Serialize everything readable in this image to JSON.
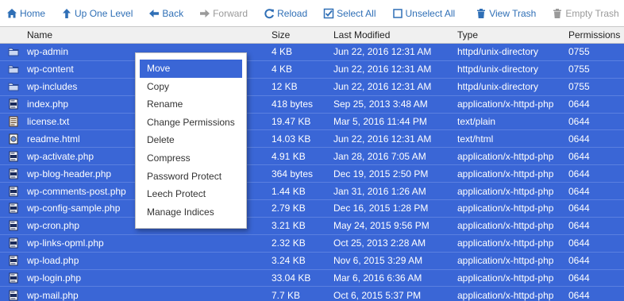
{
  "toolbar": {
    "home": {
      "label": "Home",
      "icon": "home-icon"
    },
    "up": {
      "label": "Up One Level",
      "icon": "arrow-up-icon"
    },
    "back": {
      "label": "Back",
      "icon": "arrow-left-icon"
    },
    "forward": {
      "label": "Forward",
      "icon": "arrow-right-icon"
    },
    "reload": {
      "label": "Reload",
      "icon": "reload-icon"
    },
    "select_all": {
      "label": "Select All",
      "icon": "checkbox-checked-icon"
    },
    "unselect_all": {
      "label": "Unselect All",
      "icon": "checkbox-empty-icon"
    },
    "view_trash": {
      "label": "View Trash",
      "icon": "trash-icon"
    },
    "empty_trash": {
      "label": "Empty Trash",
      "icon": "trash-icon"
    }
  },
  "columns": {
    "name": "Name",
    "size": "Size",
    "modified": "Last Modified",
    "type": "Type",
    "permissions": "Permissions"
  },
  "files": [
    {
      "name": "wp-admin",
      "size": "4 KB",
      "modified": "Jun 22, 2016 12:31 AM",
      "type": "httpd/unix-directory",
      "perm": "0755",
      "kind": "folder"
    },
    {
      "name": "wp-content",
      "size": "4 KB",
      "modified": "Jun 22, 2016 12:31 AM",
      "type": "httpd/unix-directory",
      "perm": "0755",
      "kind": "folder"
    },
    {
      "name": "wp-includes",
      "size": "12 KB",
      "modified": "Jun 22, 2016 12:31 AM",
      "type": "httpd/unix-directory",
      "perm": "0755",
      "kind": "folder"
    },
    {
      "name": "index.php",
      "size": "418 bytes",
      "modified": "Sep 25, 2013 3:48 AM",
      "type": "application/x-httpd-php",
      "perm": "0644",
      "kind": "php"
    },
    {
      "name": "license.txt",
      "size": "19.47 KB",
      "modified": "Mar 5, 2016 11:44 PM",
      "type": "text/plain",
      "perm": "0644",
      "kind": "txt"
    },
    {
      "name": "readme.html",
      "size": "14.03 KB",
      "modified": "Jun 22, 2016 12:31 AM",
      "type": "text/html",
      "perm": "0644",
      "kind": "html"
    },
    {
      "name": "wp-activate.php",
      "size": "4.91 KB",
      "modified": "Jan 28, 2016 7:05 AM",
      "type": "application/x-httpd-php",
      "perm": "0644",
      "kind": "php"
    },
    {
      "name": "wp-blog-header.php",
      "size": "364 bytes",
      "modified": "Dec 19, 2015 2:50 PM",
      "type": "application/x-httpd-php",
      "perm": "0644",
      "kind": "php"
    },
    {
      "name": "wp-comments-post.php",
      "size": "1.44 KB",
      "modified": "Jan 31, 2016 1:26 AM",
      "type": "application/x-httpd-php",
      "perm": "0644",
      "kind": "php"
    },
    {
      "name": "wp-config-sample.php",
      "size": "2.79 KB",
      "modified": "Dec 16, 2015 1:28 PM",
      "type": "application/x-httpd-php",
      "perm": "0644",
      "kind": "php"
    },
    {
      "name": "wp-cron.php",
      "size": "3.21 KB",
      "modified": "May 24, 2015 9:56 PM",
      "type": "application/x-httpd-php",
      "perm": "0644",
      "kind": "php"
    },
    {
      "name": "wp-links-opml.php",
      "size": "2.32 KB",
      "modified": "Oct 25, 2013 2:28 AM",
      "type": "application/x-httpd-php",
      "perm": "0644",
      "kind": "php"
    },
    {
      "name": "wp-load.php",
      "size": "3.24 KB",
      "modified": "Nov 6, 2015 3:29 AM",
      "type": "application/x-httpd-php",
      "perm": "0644",
      "kind": "php"
    },
    {
      "name": "wp-login.php",
      "size": "33.04 KB",
      "modified": "Mar 6, 2016 6:36 AM",
      "type": "application/x-httpd-php",
      "perm": "0644",
      "kind": "php"
    },
    {
      "name": "wp-mail.php",
      "size": "7.7 KB",
      "modified": "Oct 6, 2015 5:37 PM",
      "type": "application/x-httpd-php",
      "perm": "0644",
      "kind": "php"
    }
  ],
  "context_menu": {
    "items": [
      "Move",
      "Copy",
      "Rename",
      "Change Permissions",
      "Delete",
      "Compress",
      "Password Protect",
      "Leech Protect",
      "Manage Indices"
    ],
    "active": "Move"
  },
  "colors": {
    "accent": "#2f6fb6",
    "selection": "#3a66d6",
    "disabled": "#9a9a9a"
  }
}
